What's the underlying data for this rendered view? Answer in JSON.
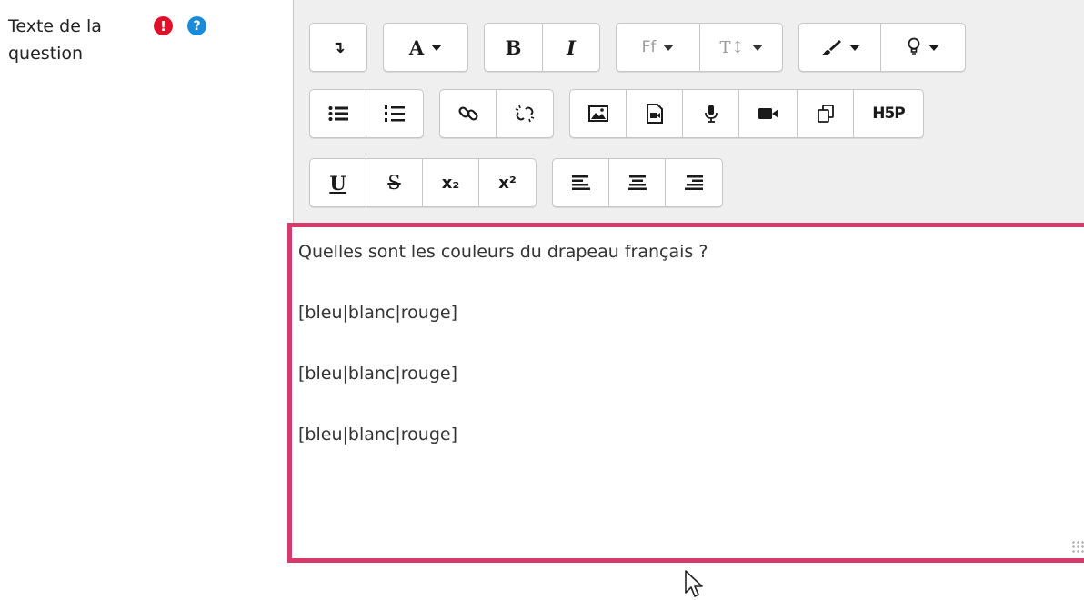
{
  "field": {
    "label": "Texte de la question",
    "required_glyph": "!",
    "help_glyph": "?"
  },
  "toolbar": {
    "row1": {
      "collapse_glyph": "↴",
      "style_label": "A",
      "bold_label": "B",
      "italic_label": "I",
      "fontfamily_label": "Ff",
      "fontsize_label": "T↕"
    },
    "row3": {
      "underline_label": "U",
      "strike_label": "S",
      "subscript_label": "x₂",
      "superscript_label": "x²"
    },
    "row2": {
      "h5p_label": "H5P"
    }
  },
  "content": {
    "lines": [
      "Quelles sont les couleurs du drapeau français ?",
      "[bleu|blanc|rouge]",
      "[bleu|blanc|rouge]",
      "[bleu|blanc|rouge]"
    ]
  },
  "colors": {
    "focus_border": "#d63a6a",
    "required": "#e0102a",
    "help": "#1a8bd8"
  }
}
